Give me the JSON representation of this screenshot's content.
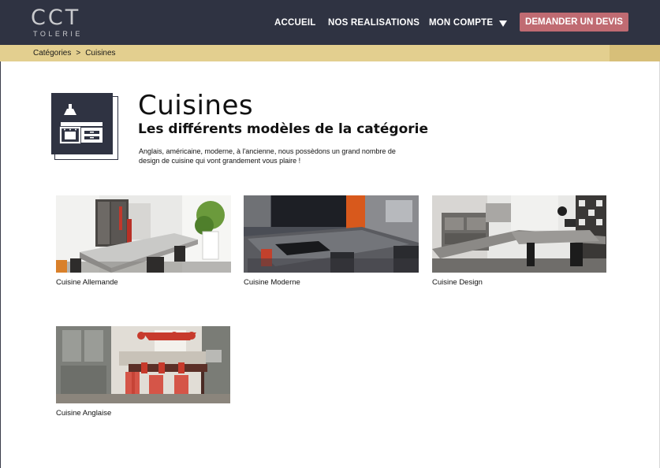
{
  "brand": {
    "logo_main": "CCT",
    "logo_sub": "TOLERIE"
  },
  "nav": {
    "items": [
      {
        "label": "ACCUEIL"
      },
      {
        "label": "NOS REALISATIONS"
      },
      {
        "label": "MON COMPTE"
      }
    ],
    "cta_label": "DEMANDER UN DEVIS"
  },
  "breadcrumb": {
    "items": [
      "Catégories",
      "Cuisines"
    ],
    "separator": ">"
  },
  "category": {
    "title": "Cuisines",
    "subtitle": "Les différents modèles de la catégorie",
    "description": "Anglais, américaine, moderne, à l'ancienne, nous possèdons un grand nombre de design de cuisine qui vont grandement vous plaire !",
    "icon": "kitchen-icon"
  },
  "products": [
    {
      "name": "Cuisine Allemande",
      "image": "kitchen-photo-allemande"
    },
    {
      "name": "Cuisine Moderne",
      "image": "kitchen-photo-moderne"
    },
    {
      "name": "Cuisine Design",
      "image": "kitchen-photo-design"
    },
    {
      "name": "Cuisine Anglaise",
      "image": "kitchen-photo-anglaise"
    }
  ],
  "colors": {
    "header_bg": "#2f3342",
    "cta_bg": "#c06b72",
    "breadcrumb_bg": "#e3cf8f",
    "text": "#111111"
  }
}
